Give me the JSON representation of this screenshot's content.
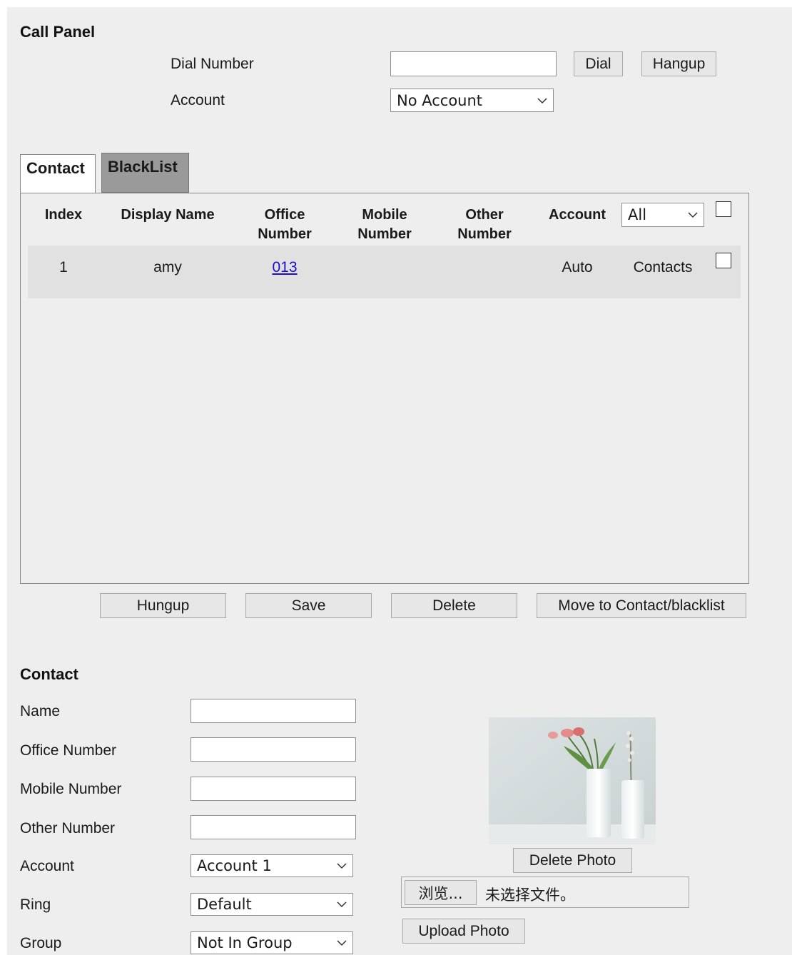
{
  "call_panel": {
    "title": "Call Panel",
    "dial_number_label": "Dial Number",
    "dial_number_value": "",
    "dial_button": "Dial",
    "hangup_button": "Hangup",
    "account_label": "Account",
    "account_selected": "No Account"
  },
  "tabs": [
    {
      "label": "Contact",
      "active": true
    },
    {
      "label": "BlackList",
      "active": false
    }
  ],
  "table": {
    "headers": {
      "index": "Index",
      "display_name": "Display Name",
      "office_line1": "Office",
      "office_line2": "Number",
      "mobile_line1": "Mobile",
      "mobile_line2": "Number",
      "other_line1": "Other",
      "other_line2": "Number",
      "account": "Account",
      "account_filter": "All"
    },
    "rows": [
      {
        "index": "1",
        "display_name": "amy",
        "office_number": "013",
        "mobile_number": "",
        "other_number": "",
        "account": "Auto",
        "group": "Contacts"
      }
    ]
  },
  "actions": {
    "hungup": "Hungup",
    "save": "Save",
    "delete": "Delete",
    "move": "Move to Contact/blacklist"
  },
  "contact_form": {
    "title": "Contact",
    "name_label": "Name",
    "name_value": "",
    "office_label": "Office Number",
    "office_value": "",
    "mobile_label": "Mobile Number",
    "mobile_value": "",
    "other_label": "Other Number",
    "other_value": "",
    "account_label": "Account",
    "account_selected": "Account 1",
    "ring_label": "Ring",
    "ring_selected": "Default",
    "group_label": "Group",
    "group_selected": "Not In Group"
  },
  "photo": {
    "delete_button": "Delete Photo",
    "browse_button": "浏览...",
    "no_file_text": "未选择文件。",
    "upload_button": "Upload Photo"
  },
  "icons": {
    "dropdown": "chevron-down-icon",
    "checkbox": "checkbox-icon"
  }
}
